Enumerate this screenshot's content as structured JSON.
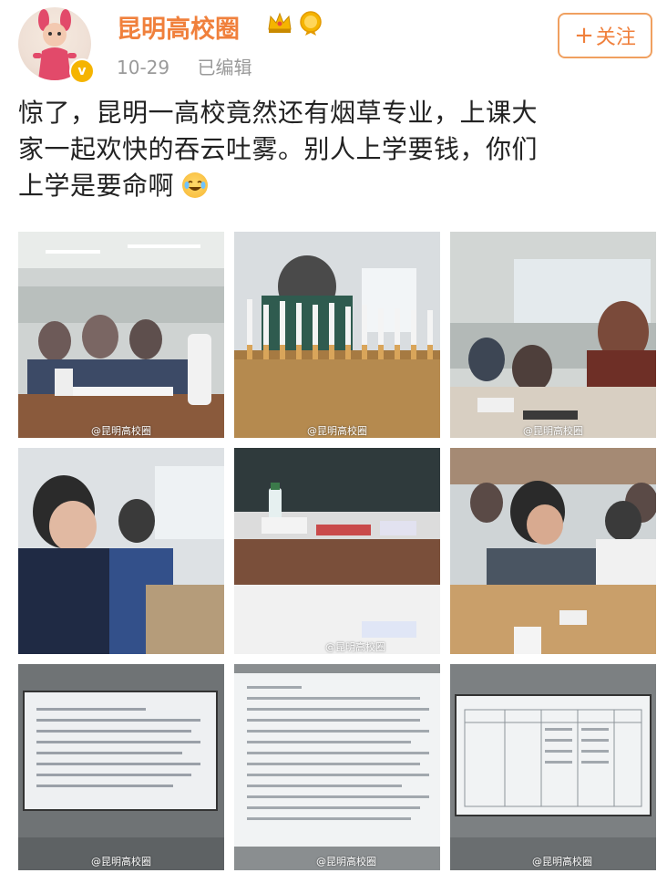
{
  "author": {
    "name": "昆明高校圈",
    "badge_icons": [
      "crown-icon",
      "medal-icon"
    ],
    "verified_icon": "verified-v-icon"
  },
  "post_meta": {
    "date": "10-29",
    "edited": "已编辑"
  },
  "follow_button": {
    "label": "关注",
    "icon": "plus-icon"
  },
  "post": {
    "line1": "惊了，昆明一高校竟然还有烟草专业，上课大",
    "line2": "家一起欢快的吞云吐雾。别人上学要钱，你们",
    "line3": "上学是要命啊",
    "emoji": "laugh-cry-emoji"
  },
  "images": {
    "watermark": "@昆明高校圈",
    "row1": [
      "classroom-smoking-photo",
      "cigarette-row-photo",
      "students-smoking-photo"
    ],
    "row2": [
      "students-closeup-photo",
      "teacher-desk-photo",
      "student-smoking-desk-photo"
    ],
    "row3": [
      "projector-slide-photo-1",
      "projector-slide-photo-2",
      "projector-table-photo"
    ]
  },
  "colors": {
    "name": "#f0803c",
    "button_border": "#f0a060",
    "meta_gray": "#9a9a9a",
    "text": "#222222"
  }
}
